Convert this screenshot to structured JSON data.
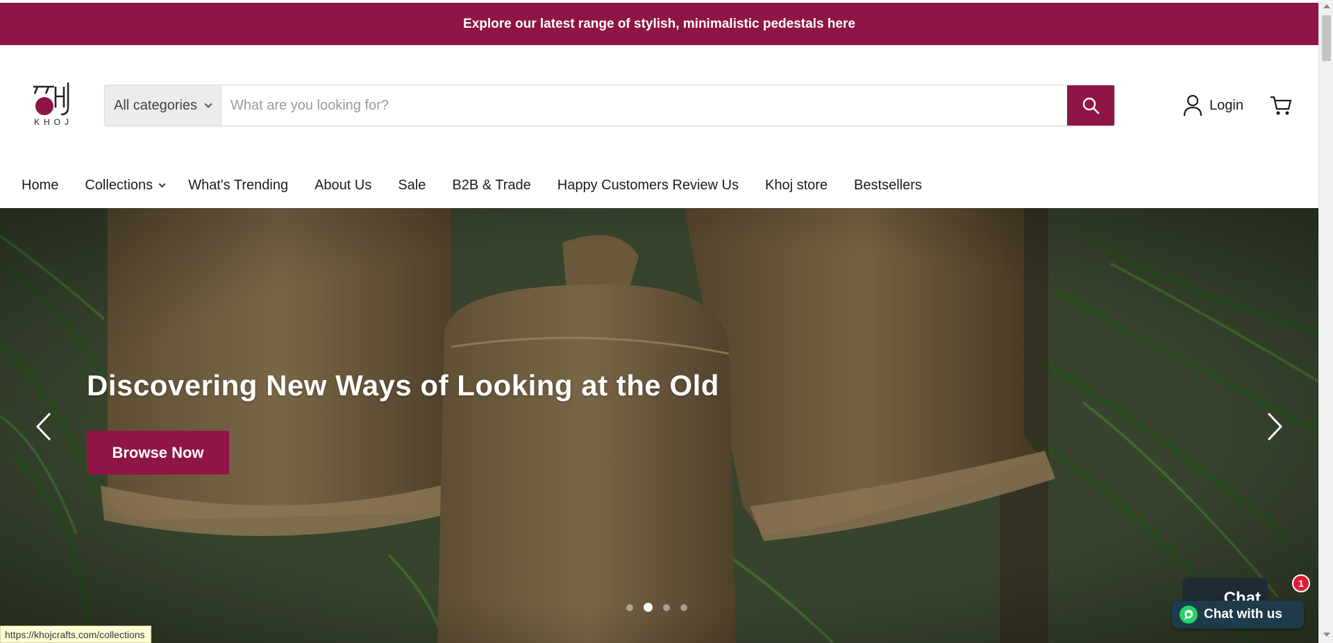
{
  "announcement": {
    "text": "Explore our latest range of stylish, minimalistic pedestals here"
  },
  "header": {
    "logo": {
      "name": "khoj-logo",
      "wordmark": "KHOJ",
      "brand_color": "#8f1546"
    },
    "search": {
      "category_label": "All categories",
      "placeholder": "What are you looking for?",
      "value": "",
      "button_icon": "search-icon"
    },
    "login_label": "Login",
    "cart_icon": "cart-icon"
  },
  "nav": {
    "items": [
      {
        "label": "Home",
        "has_dropdown": false
      },
      {
        "label": "Collections",
        "has_dropdown": true
      },
      {
        "label": "What's Trending",
        "has_dropdown": false
      },
      {
        "label": "About Us",
        "has_dropdown": false
      },
      {
        "label": "Sale",
        "has_dropdown": false
      },
      {
        "label": "B2B & Trade",
        "has_dropdown": false
      },
      {
        "label": "Happy Customers Review Us",
        "has_dropdown": false
      },
      {
        "label": "Khoj store",
        "has_dropdown": false
      },
      {
        "label": "Bestsellers",
        "has_dropdown": false
      }
    ]
  },
  "hero": {
    "title": "Discovering New Ways of Looking at the Old",
    "button_label": "Browse Now",
    "prev_icon": "chevron-left-icon",
    "next_icon": "chevron-right-icon",
    "slide_count": 4,
    "active_slide": 2
  },
  "chat": {
    "back_label": "Chat",
    "front_label": "Chat with us",
    "badge_count": "1",
    "icon": "whatsapp-icon"
  },
  "status_bar": {
    "url": "https://khojcrafts.com/collections"
  },
  "colors": {
    "brand": "#8f1546",
    "chat_badge": "#e01b3a",
    "whatsapp": "#25d366"
  }
}
